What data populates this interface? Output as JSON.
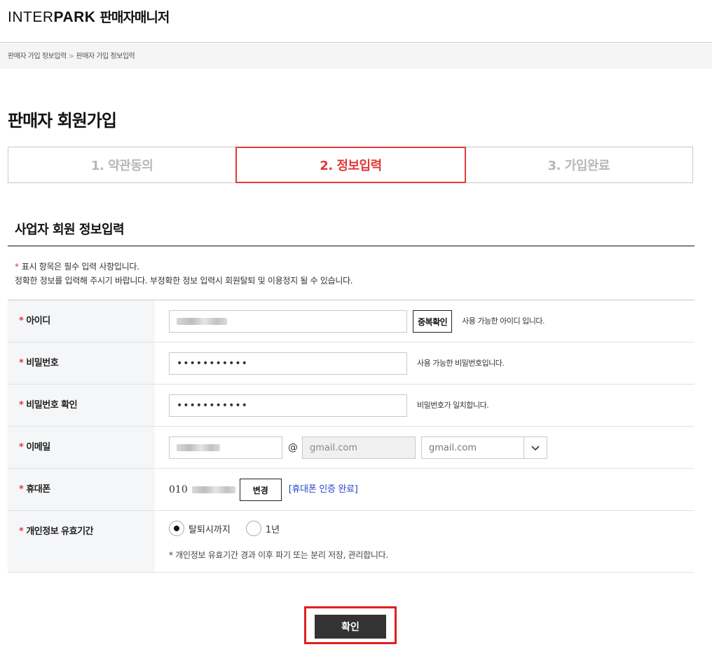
{
  "header": {
    "brand_light": "INTER",
    "brand_bold": "PARK",
    "service": "판매자매니저"
  },
  "breadcrumb": {
    "item1": "판매자 가입 정보입력",
    "separator": ">",
    "item2": "판매자 가입 정보입력"
  },
  "page_title": "판매자 회원가입",
  "steps": [
    {
      "label": "1. 약관동의",
      "active": false
    },
    {
      "label": "2. 정보입력",
      "active": true
    },
    {
      "label": "3. 가입완료",
      "active": false
    }
  ],
  "section_title": "사업자 회원 정보입력",
  "notice": {
    "star": "*",
    "line1": "표시 항목은 필수 입력 사항입니다.",
    "line2": "정확한 정보를 입력해 주시기 바랍니다. 부정확한 정보 입력시 회원탈퇴 및 이용정지 될 수 있습니다."
  },
  "form": {
    "required_mark": "*",
    "id": {
      "label": "아이디",
      "check_button": "중복확인",
      "hint": "사용 가능한 아이디 입니다."
    },
    "password": {
      "label": "비밀번호",
      "value": "•••••••••••",
      "hint": "사용 가능한 비밀번호입니다."
    },
    "password_confirm": {
      "label": "비밀번호 확인",
      "value": "•••••••••••",
      "hint": "비밀번호가 일치합니다."
    },
    "email": {
      "label": "이메일",
      "at": "@",
      "domain_placeholder": "gmail.com",
      "domain_select": "gmail.com"
    },
    "phone": {
      "label": "휴대폰",
      "prefix": "010",
      "change_button": "변경",
      "status": "[휴대폰 인증 완료]"
    },
    "retention": {
      "label": "개인정보 유효기간",
      "options": [
        {
          "label": "탈퇴시까지",
          "checked": true
        },
        {
          "label": "1년",
          "checked": false
        }
      ],
      "note": "* 개인정보 유효기간 경과 이후 파기 또는 분리 저장, 관리합니다."
    }
  },
  "confirm_button": "확인",
  "colors": {
    "accent_red": "#e03a3a",
    "link_blue": "#2547c9",
    "dark_button": "#333333"
  }
}
